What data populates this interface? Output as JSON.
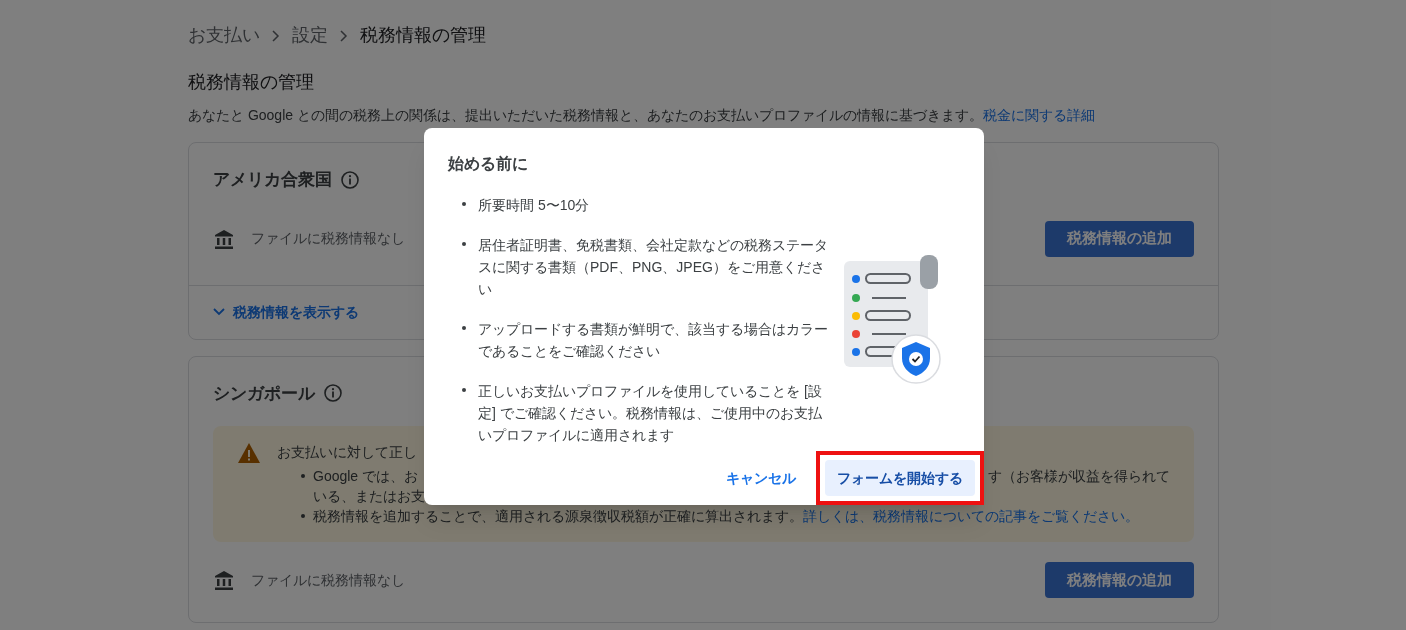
{
  "breadcrumb": [
    "お支払い",
    "設定",
    "税務情報の管理"
  ],
  "page_title": "税務情報の管理",
  "description": {
    "text": "あなたと Google との間の税務上の関係は、提出いただいた税務情報と、あなたのお支払いプロファイルの情報に基づきます。",
    "link": "税金に関する詳細"
  },
  "sections": [
    {
      "country": "アメリカ合衆国",
      "status": "ファイルに税務情報なし",
      "add_button": "税務情報の追加",
      "expand_link": "税務情報を表示する"
    },
    {
      "country": "シンガポール",
      "warning": {
        "title": "お支払いに対して正し",
        "bullets": [
          {
            "left": [
              "Google では、お",
              "いる、またはお支"
            ],
            "right": "す（お客様が収益を得られて"
          },
          {
            "text": "税務情報を追加することで、適用される源泉徴収税額が正確に算出されます。",
            "link": "詳しくは、税務情報についての記事をご覧ください。"
          }
        ]
      },
      "status": "ファイルに税務情報なし",
      "add_button": "税務情報の追加"
    }
  ],
  "dialog": {
    "title": "始める前に",
    "bullets": [
      "所要時間 5〜10分",
      "居住者証明書、免税書類、会社定款などの税務ステータスに関する書類（PDF、PNG、JPEG）をご用意ください",
      "アップロードする書類が鮮明で、該当する場合はカラーであることをご確認ください",
      "正しいお支払いプロファイルを使用していることを [設定] でご確認ください。税務情報は、ご使用中のお支払いプロファイルに適用されます"
    ],
    "cancel_button": "キャンセル",
    "start_button": {
      "label": "フォームを開始する",
      "highlighted": true
    }
  }
}
